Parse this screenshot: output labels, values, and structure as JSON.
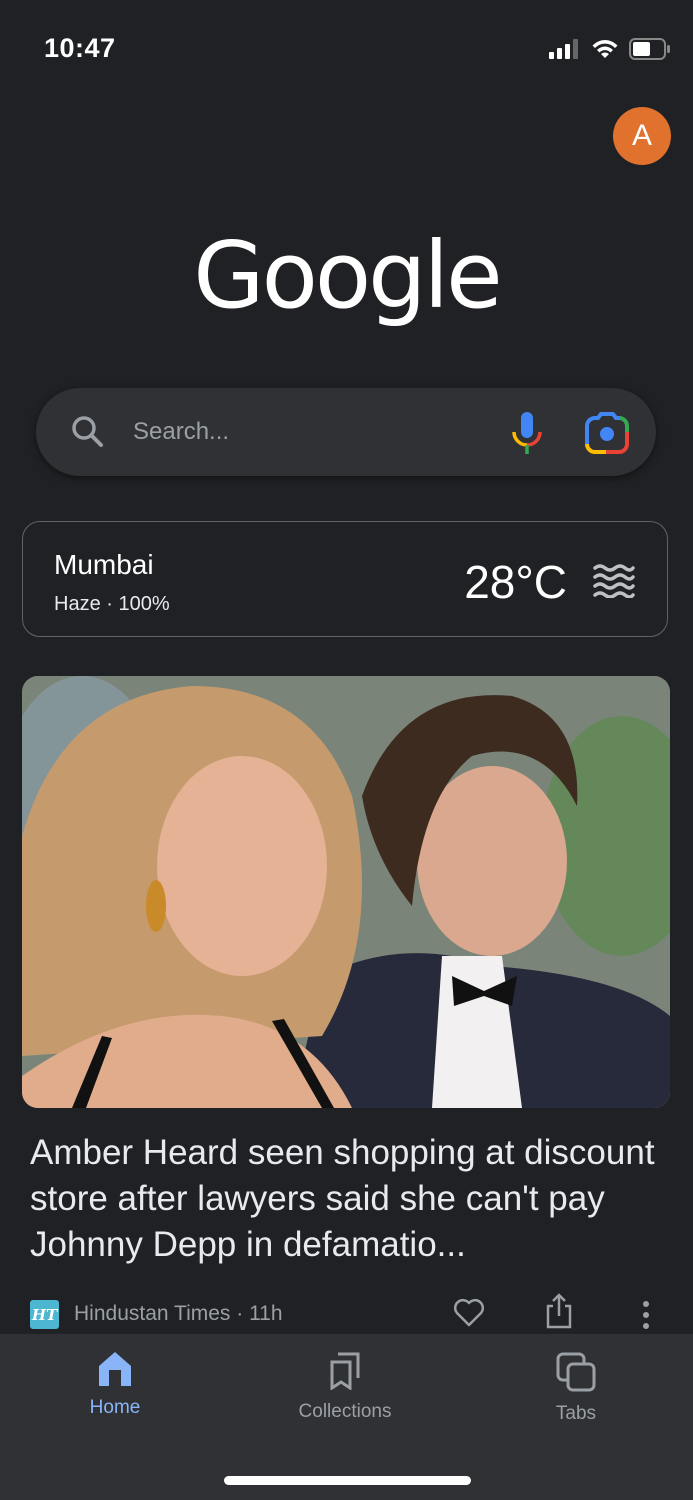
{
  "status_bar": {
    "time": "10:47",
    "battery_level_percent": 60
  },
  "account": {
    "avatar_initial": "A",
    "avatar_color": "#e0722d"
  },
  "logo": {
    "text": "Google"
  },
  "search": {
    "placeholder": "Search...",
    "voice_icon": "mic-icon",
    "lens_icon": "google-lens-icon"
  },
  "weather": {
    "city": "Mumbai",
    "description": "Haze · 100%",
    "temperature": "28°C",
    "condition_icon": "haze-icon"
  },
  "news": [
    {
      "image_alt": "Amber Heard and Johnny Depp at a red carpet event",
      "headline": "Amber Heard seen shopping at discount store after lawyers said she can't pay Johnny Depp in defamatio...",
      "source_logo_text": "HT",
      "source": "Hindustan Times · 11h"
    }
  ],
  "bottom_nav": {
    "items": [
      {
        "label": "Home",
        "icon": "home-icon",
        "active": true
      },
      {
        "label": "Collections",
        "icon": "collections-icon",
        "active": false
      },
      {
        "label": "Tabs",
        "icon": "tabs-icon",
        "active": false
      }
    ]
  },
  "colors": {
    "background": "#202124",
    "surface": "#303134",
    "accent": "#8ab4f8",
    "muted_text": "#9aa0a6"
  }
}
